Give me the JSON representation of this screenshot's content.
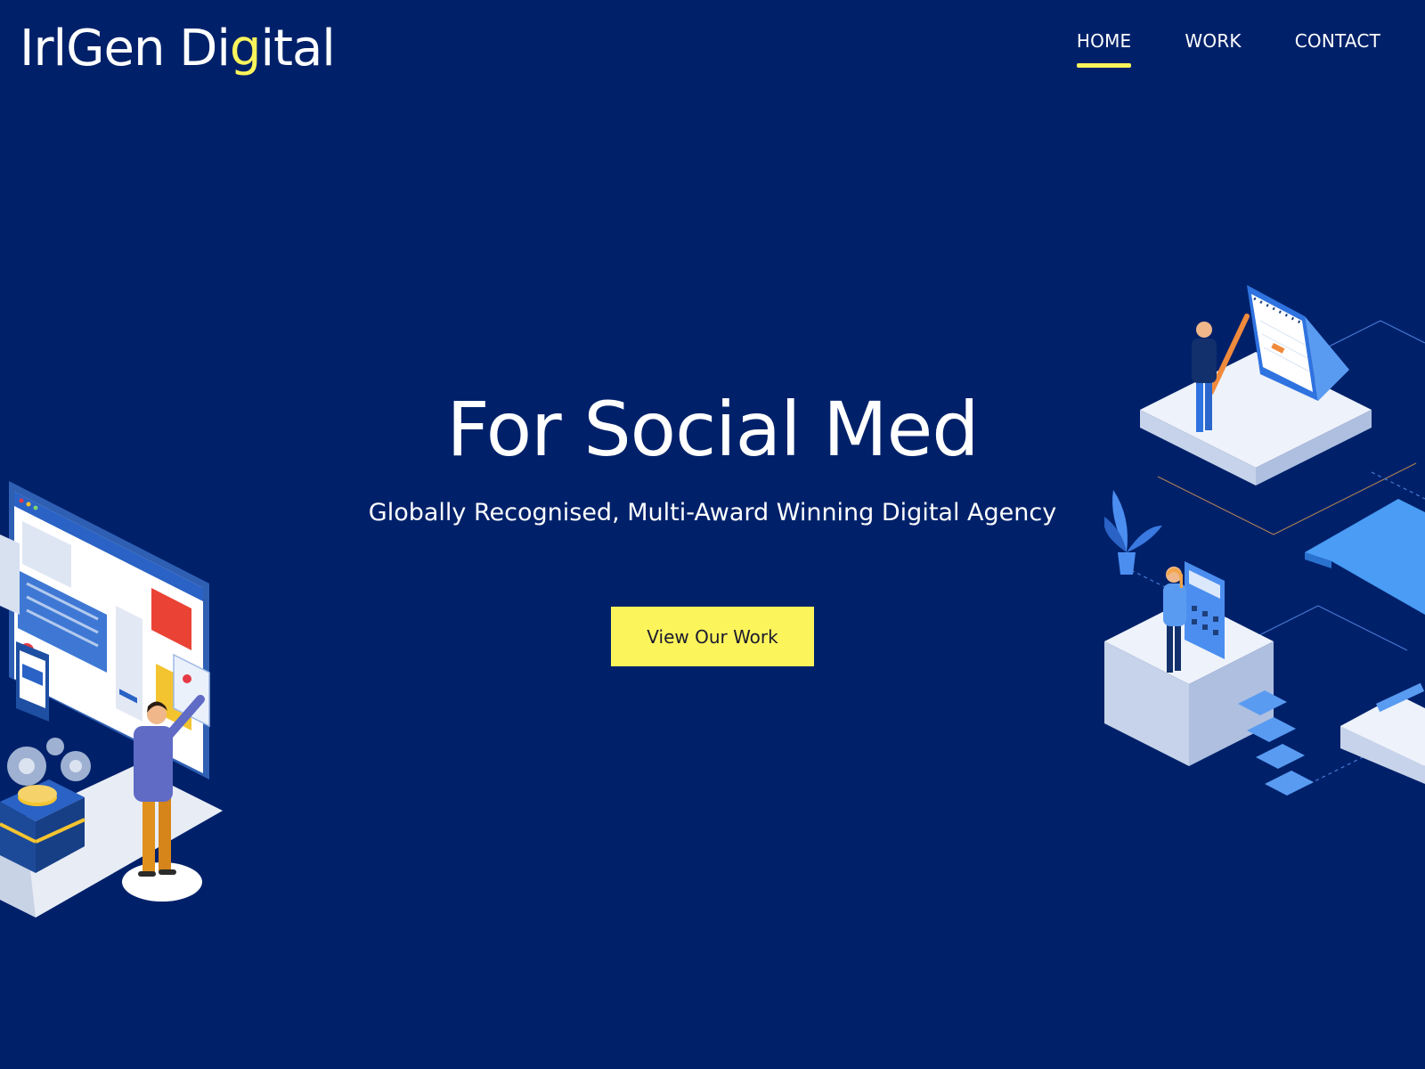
{
  "brand": {
    "logo_pre": "IrlGen Di",
    "logo_accent": "g",
    "logo_post": "ital"
  },
  "nav": {
    "items": [
      {
        "label": "HOME",
        "active": true
      },
      {
        "label": "WORK",
        "active": false
      },
      {
        "label": "CONTACT",
        "active": false
      }
    ]
  },
  "hero": {
    "title": "For Social Med",
    "subtitle": "Globally Recognised, Multi-Award Winning Digital Agency",
    "cta_label": "View Our Work"
  },
  "colors": {
    "background": "#00216a",
    "accent": "#fcf45b",
    "text": "#ffffff"
  }
}
